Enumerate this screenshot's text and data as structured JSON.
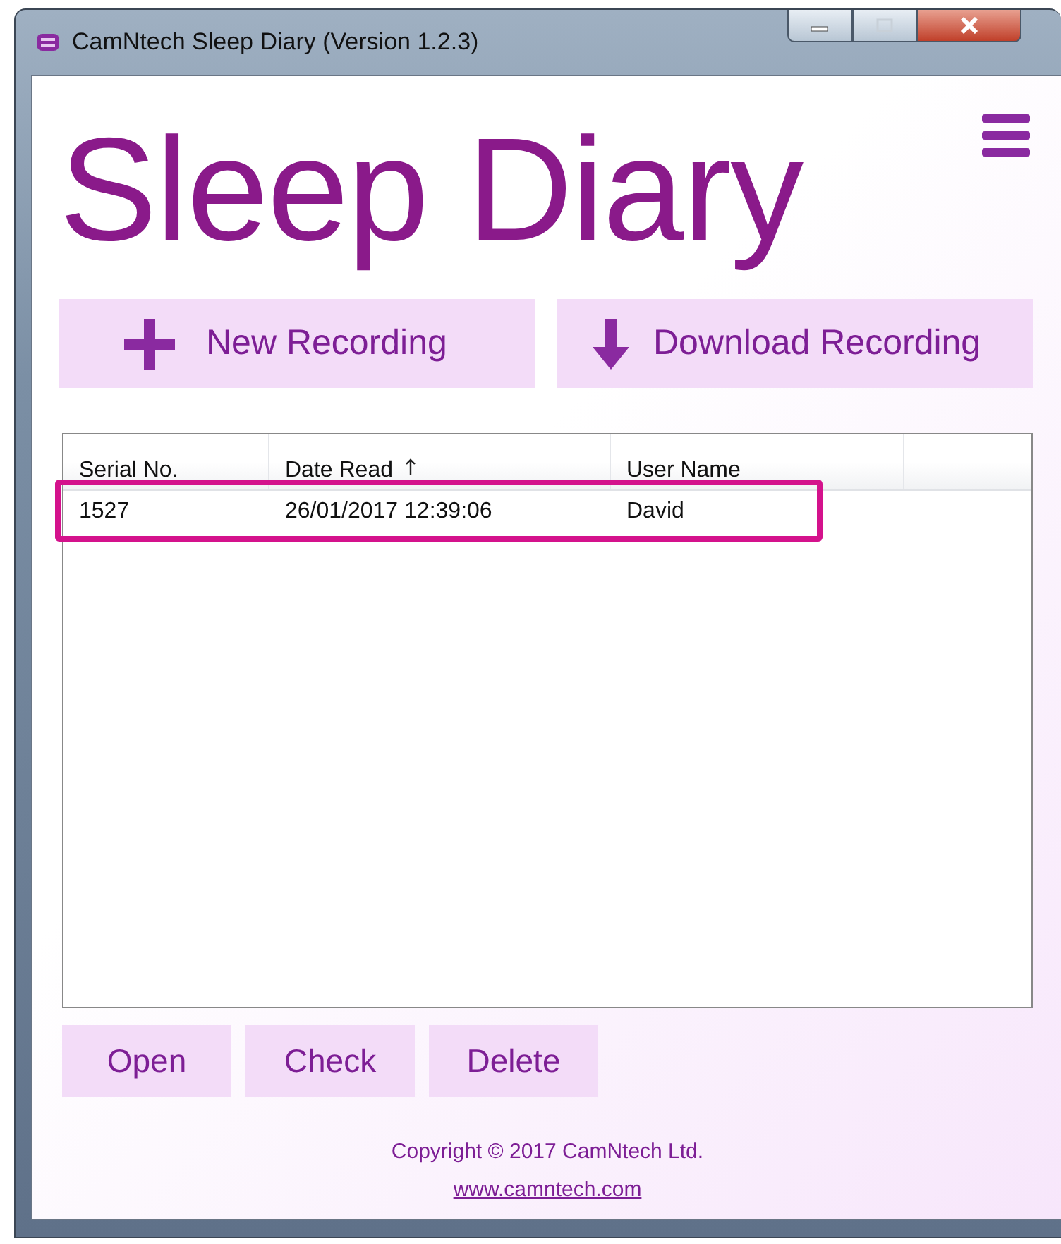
{
  "window": {
    "title": "CamNtech Sleep Diary (Version 1.2.3)"
  },
  "heading": "Sleep Diary",
  "actions": [
    {
      "label": "New Recording",
      "kind": "plus"
    },
    {
      "label": "Download Recording",
      "kind": "download"
    }
  ],
  "table": {
    "columns": [
      {
        "label": "Serial No.",
        "sorted": false
      },
      {
        "label": "Date Read",
        "sorted": true
      },
      {
        "label": "User Name",
        "sorted": false
      }
    ],
    "rows": [
      {
        "cells": [
          "1527",
          "26/01/2017 12:39:06",
          "David"
        ],
        "highlighted": true
      }
    ]
  },
  "buttons": [
    "Open",
    "Check",
    "Delete"
  ],
  "footer": {
    "copyright": "Copyright © 2017 CamNtech Ltd.",
    "link": "www.camntech.com"
  }
}
